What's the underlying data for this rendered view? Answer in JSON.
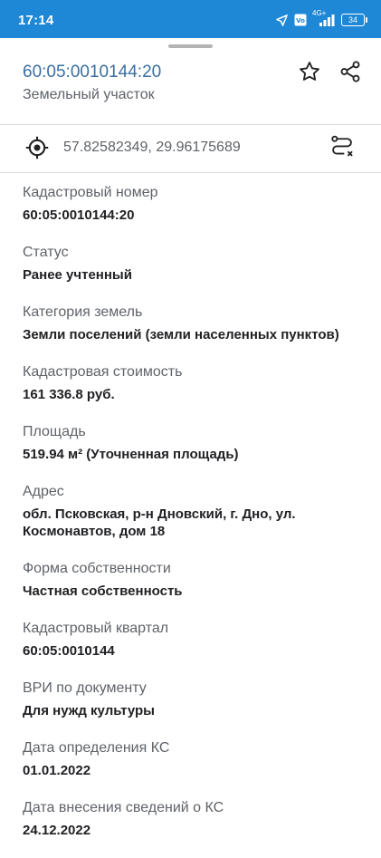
{
  "status_bar": {
    "time": "17:14",
    "network_label": "4G+",
    "battery_level": "34",
    "icons": [
      "location-arrow-icon",
      "volte-icon",
      "signal-icon",
      "battery-icon"
    ]
  },
  "header": {
    "title": "60:05:0010144:20",
    "subtitle": "Земельный участок",
    "actions": [
      "star-icon",
      "share-icon"
    ]
  },
  "coordinates": {
    "text": "57.82582349, 29.96175689",
    "icons": [
      "locate-icon",
      "route-icon"
    ]
  },
  "fields": [
    {
      "label": "Кадастровый номер",
      "value": "60:05:0010144:20"
    },
    {
      "label": "Статус",
      "value": "Ранее учтенный"
    },
    {
      "label": "Категория земель",
      "value": "Земли поселений (земли населенных пунктов)"
    },
    {
      "label": "Кадастровая стоимость",
      "value": "161 336.8 руб."
    },
    {
      "label": "Площадь",
      "value": "519.94 м² (Уточненная площадь)"
    },
    {
      "label": "Адрес",
      "value": "обл. Псковская, р-н Дновский, г. Дно, ул.\nКосмонавтов, дом 18"
    },
    {
      "label": "Форма собственности",
      "value": "Частная собственность"
    },
    {
      "label": "Кадастровый квартал",
      "value": "60:05:0010144"
    },
    {
      "label": "ВРИ по документу",
      "value": "Для нужд культуры"
    },
    {
      "label": "Дата определения КС",
      "value": "01.01.2022"
    },
    {
      "label": "Дата внесения сведений о КС",
      "value": "24.12.2022"
    }
  ],
  "colors": {
    "status_bar": "#1e88d6",
    "title": "#3a6fa0",
    "label": "#5f6368",
    "value": "#202124"
  }
}
